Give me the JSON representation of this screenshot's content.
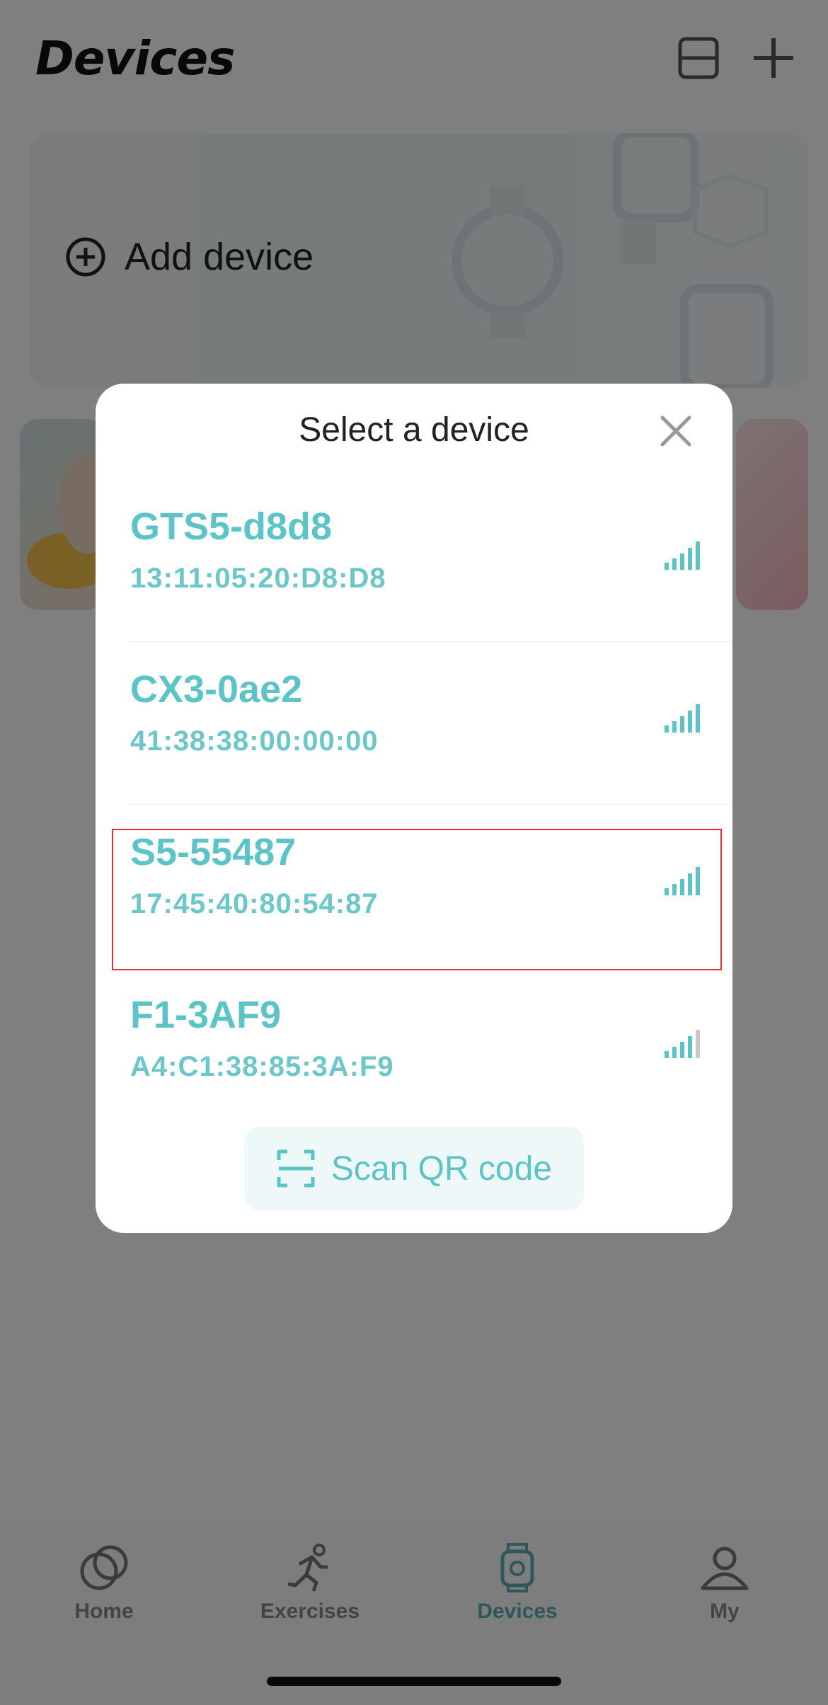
{
  "header": {
    "title": "Devices",
    "icons": [
      "list-toggle-icon",
      "plus-icon"
    ]
  },
  "hero": {
    "add_device_label": "Add device"
  },
  "modal": {
    "title": "Select a device",
    "devices": [
      {
        "name": "GTS5-d8d8",
        "mac": "13:11:05:20:D8:D8",
        "signal_bars": 5,
        "selected": false
      },
      {
        "name": "CX3-0ae2",
        "mac": "41:38:38:00:00:00",
        "signal_bars": 5,
        "selected": false
      },
      {
        "name": "S5-55487",
        "mac": "17:45:40:80:54:87",
        "signal_bars": 5,
        "selected": true
      },
      {
        "name": "F1-3AF9",
        "mac": "A4:C1:38:85:3A:F9",
        "signal_bars": 4,
        "selected": false
      }
    ],
    "scan_label": "Scan QR code"
  },
  "tabs": [
    {
      "label": "Home",
      "icon": "home-icon",
      "active": false
    },
    {
      "label": "Exercises",
      "icon": "runner-icon",
      "active": false
    },
    {
      "label": "Devices",
      "icon": "watch-icon",
      "active": true
    },
    {
      "label": "My",
      "icon": "person-icon",
      "active": false
    }
  ],
  "colors": {
    "accent": "#5cc3c6",
    "highlight": "#e4332f",
    "overlay": "rgba(0,0,0,0.5)"
  }
}
